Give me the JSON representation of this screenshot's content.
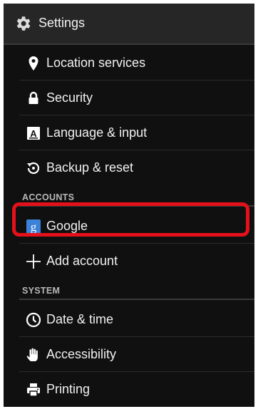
{
  "actionbar": {
    "title": "Settings",
    "icon": "gear-icon"
  },
  "items": [
    {
      "label": "Location services",
      "icon": "location-pin-icon"
    },
    {
      "label": "Security",
      "icon": "lock-icon"
    },
    {
      "label": "Language & input",
      "icon": "keyboard-a-icon"
    },
    {
      "label": "Backup & reset",
      "icon": "backup-restore-icon"
    }
  ],
  "accounts_section": {
    "header": "ACCOUNTS"
  },
  "accounts": [
    {
      "label": "Google",
      "icon": "google-g-icon"
    },
    {
      "label": "Add account",
      "icon": "plus-icon"
    }
  ],
  "system_section": {
    "header": "SYSTEM"
  },
  "system": [
    {
      "label": "Date & time",
      "icon": "clock-icon"
    },
    {
      "label": "Accessibility",
      "icon": "hand-icon"
    },
    {
      "label": "Printing",
      "icon": "printer-icon"
    }
  ],
  "colors": {
    "highlight": "#e4101a",
    "background": "#101010",
    "google_blue": "#3b82d8"
  }
}
